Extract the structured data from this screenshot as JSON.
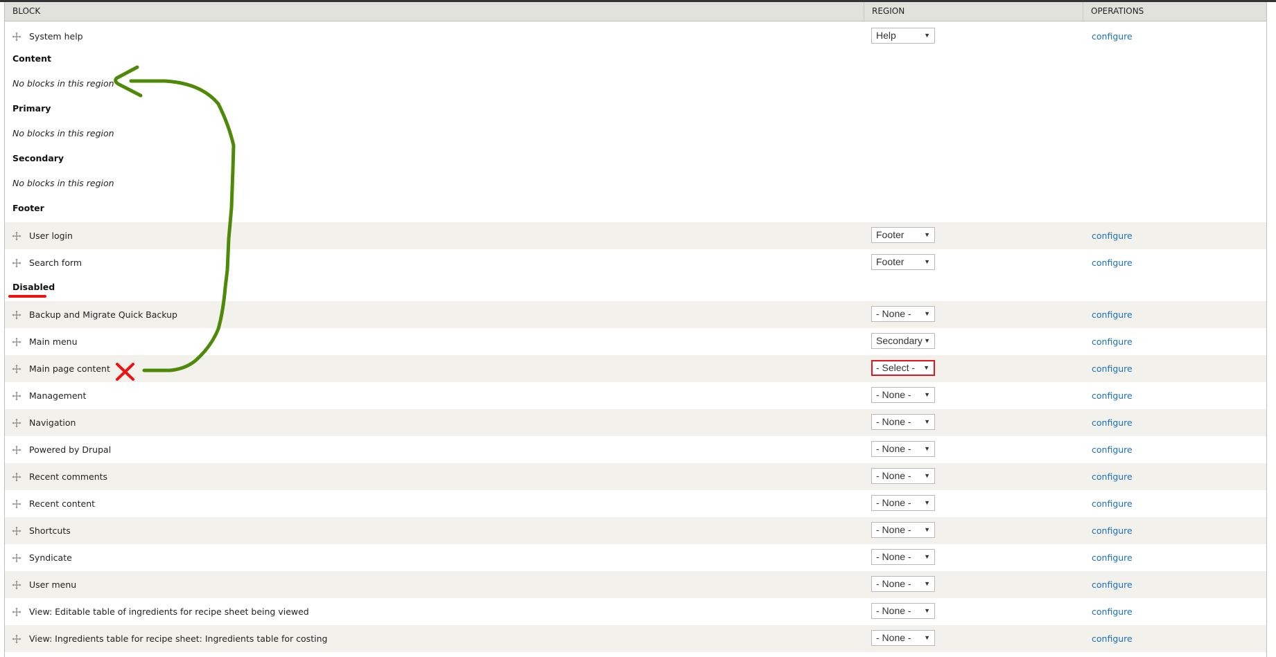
{
  "table": {
    "headers": {
      "block": "Block",
      "region": "Region",
      "operations": "Operations"
    },
    "configure_label": "configure",
    "empty_region_text": "No blocks in this region"
  },
  "sections": [
    {
      "heading": null,
      "blocks": [
        {
          "name": "System help",
          "region": "Help"
        }
      ]
    },
    {
      "heading": "Content",
      "blocks": []
    },
    {
      "heading": "Primary",
      "blocks": []
    },
    {
      "heading": "Secondary",
      "blocks": []
    },
    {
      "heading": "Footer",
      "blocks": [
        {
          "name": "User login",
          "region": "Footer"
        },
        {
          "name": "Search form",
          "region": "Footer"
        }
      ]
    },
    {
      "heading": "Disabled",
      "blocks": [
        {
          "name": "Backup and Migrate Quick Backup",
          "region": "- None -"
        },
        {
          "name": "Main menu",
          "region": "Secondary"
        },
        {
          "name": "Main page content",
          "region": "- Select -",
          "highlighted": true
        },
        {
          "name": "Management",
          "region": "- None -"
        },
        {
          "name": "Navigation",
          "region": "- None -"
        },
        {
          "name": "Powered by Drupal",
          "region": "- None -"
        },
        {
          "name": "Recent comments",
          "region": "- None -"
        },
        {
          "name": "Recent content",
          "region": "- None -"
        },
        {
          "name": "Shortcuts",
          "region": "- None -"
        },
        {
          "name": "Syndicate",
          "region": "- None -"
        },
        {
          "name": "User menu",
          "region": "- None -"
        },
        {
          "name": "View: Editable table of ingredients for recipe sheet being viewed",
          "region": "- None -"
        },
        {
          "name": "View: Ingredients table for recipe sheet: Ingredients table for costing",
          "region": "- None -"
        }
      ]
    }
  ],
  "annotations": {
    "arrow": {
      "color": "#4e8a08",
      "from_block": "Main page content",
      "to_region": "Content"
    },
    "x_mark": {
      "color": "#ee1111",
      "target_block": "Main page content"
    },
    "underline": {
      "color": "#ee1111",
      "target_heading": "Disabled"
    }
  },
  "colors": {
    "link": "#1a70b8",
    "row_alt": "#f2f1eb",
    "header_bg": "#e1e2dc"
  }
}
